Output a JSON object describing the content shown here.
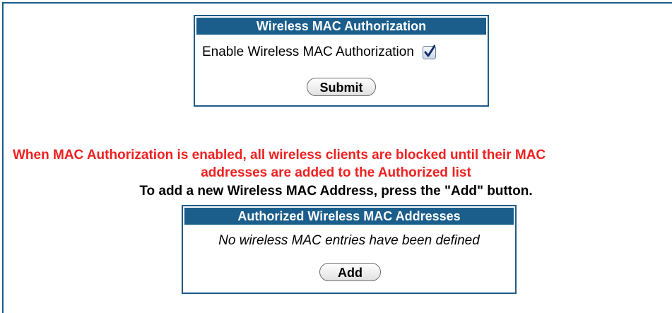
{
  "mac_auth": {
    "title": "Wireless MAC Authorization",
    "enable_label": "Enable Wireless MAC Authorization",
    "enable_checked": true,
    "submit_label": "Submit"
  },
  "notice": {
    "line1": "When MAC Authorization is enabled, all wireless clients are blocked until their MAC",
    "line2": "addresses are added to the Authorized list",
    "color": "#f02020"
  },
  "instruction": "To add a new Wireless MAC Address, press the \"Add\" button.",
  "authorized": {
    "title": "Authorized Wireless MAC Addresses",
    "empty_message": "No wireless MAC entries have been defined",
    "add_label": "Add"
  },
  "colors": {
    "header_bg": "#1b5e8c",
    "border": "#1f5b86"
  }
}
